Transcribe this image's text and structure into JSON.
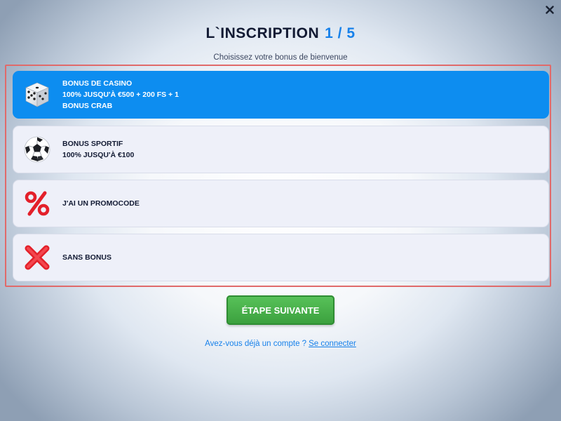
{
  "header": {
    "title": "L`INSCRIPTION",
    "step": "1 / 5",
    "subtitle": "Choisissez votre bonus de bienvenue"
  },
  "options": [
    {
      "lines": [
        "BONUS DE CASINO",
        "100% JUSQU'À €500 + 200 FS + 1",
        "BONUS CRAB"
      ],
      "icon": "dice-icon",
      "selected": true
    },
    {
      "lines": [
        "BONUS SPORTIF",
        "100% JUSQU'À €100"
      ],
      "icon": "soccer-ball-icon",
      "selected": false
    },
    {
      "lines": [
        "J'AI UN PROMOCODE"
      ],
      "icon": "percent-icon",
      "selected": false
    },
    {
      "lines": [
        "SANS BONUS"
      ],
      "icon": "red-cross-icon",
      "selected": false
    }
  ],
  "footer": {
    "next_label": "ÉTAPE SUIVANTE",
    "account_question": "Avez-vous déjà un compte ?",
    "login_link": "Se connecter"
  },
  "colors": {
    "accent": "#1781ea",
    "selected_option": "#0d8df0",
    "next_button": "#4bb24d",
    "frame_border": "#e06a6a"
  }
}
